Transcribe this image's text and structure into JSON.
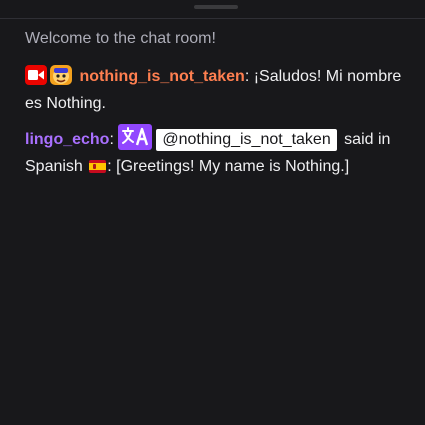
{
  "chat": {
    "welcome": "Welcome to the chat room!",
    "messages": [
      {
        "username": "nothing_is_not_taken",
        "separator": ":",
        "text": " ¡Saludos! Mi nombre es Nothing.",
        "badges": [
          "live-camera-icon",
          "emote-badge-icon"
        ],
        "username_color": "#ff7f50"
      },
      {
        "username": "lingo_echo",
        "separator": ":",
        "mention": "@nothing_is_not_taken",
        "text_before_flag": " said in Spanish ",
        "text_after_flag": ": [Greetings! My name is Nothing.]",
        "badges": [
          "translate-icon",
          "spain-flag-icon"
        ],
        "username_color": "#a970ff"
      }
    ]
  },
  "colors": {
    "background": "#18181b",
    "welcome_text": "#adadb8",
    "text": "#efeff1",
    "accent_purple": "#9147ff",
    "live_red": "#eb0400"
  }
}
